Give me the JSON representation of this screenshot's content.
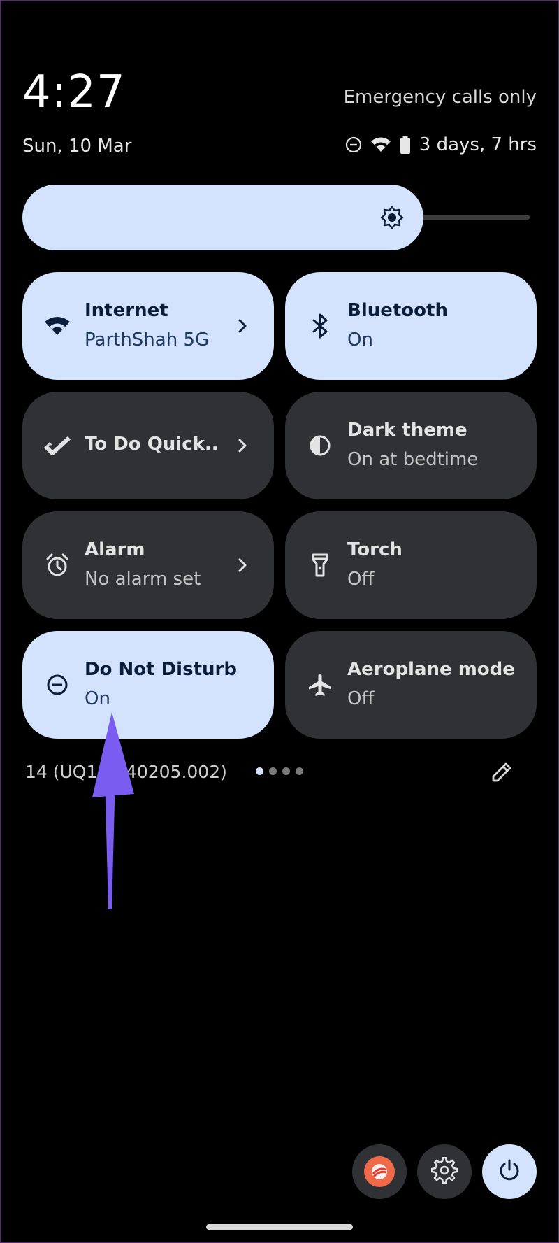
{
  "header": {
    "time": "4:27",
    "network_status": "Emergency calls only",
    "date": "Sun, 10 Mar",
    "battery_text": "3 days, 7 hrs",
    "status_icons": [
      "do-not-disturb-icon",
      "wifi-icon",
      "battery-icon"
    ]
  },
  "brightness": {
    "level": 0.8,
    "icon": "brightness-icon"
  },
  "tiles": [
    {
      "label": "Internet",
      "sub": "ParthShah 5G",
      "state": "on",
      "icon": "wifi-icon",
      "chevron": true
    },
    {
      "label": "Bluetooth",
      "sub": "On",
      "state": "on",
      "icon": "bluetooth-icon",
      "chevron": false
    },
    {
      "label": "To Do Quick..",
      "sub": "",
      "state": "off",
      "icon": "checkmark-icon",
      "chevron": true
    },
    {
      "label": "Dark theme",
      "sub": "On at bedtime",
      "state": "off",
      "icon": "dark-theme-icon",
      "chevron": false
    },
    {
      "label": "Alarm",
      "sub": "No alarm set",
      "state": "off",
      "icon": "alarm-icon",
      "chevron": true
    },
    {
      "label": "Torch",
      "sub": "Off",
      "state": "off",
      "icon": "torch-icon",
      "chevron": false
    },
    {
      "label": "Do Not Disturb",
      "sub": "On",
      "state": "on",
      "icon": "do-not-disturb-icon",
      "chevron": false
    },
    {
      "label": "Aeroplane mode",
      "sub": "Off",
      "state": "off",
      "icon": "airplane-icon",
      "chevron": false
    }
  ],
  "footer": {
    "build_number": "14 (UQ1A.240205.002)",
    "page_indicator": {
      "pages": 4,
      "current": 1
    },
    "edit_icon": "pencil-icon"
  },
  "bottom_buttons": [
    "user-icon",
    "gear-icon",
    "power-icon"
  ],
  "colors": {
    "background": "#000000",
    "tile_on": "#d3e3fd",
    "tile_off": "#303134",
    "annotation_arrow": "#7b5cf0"
  }
}
